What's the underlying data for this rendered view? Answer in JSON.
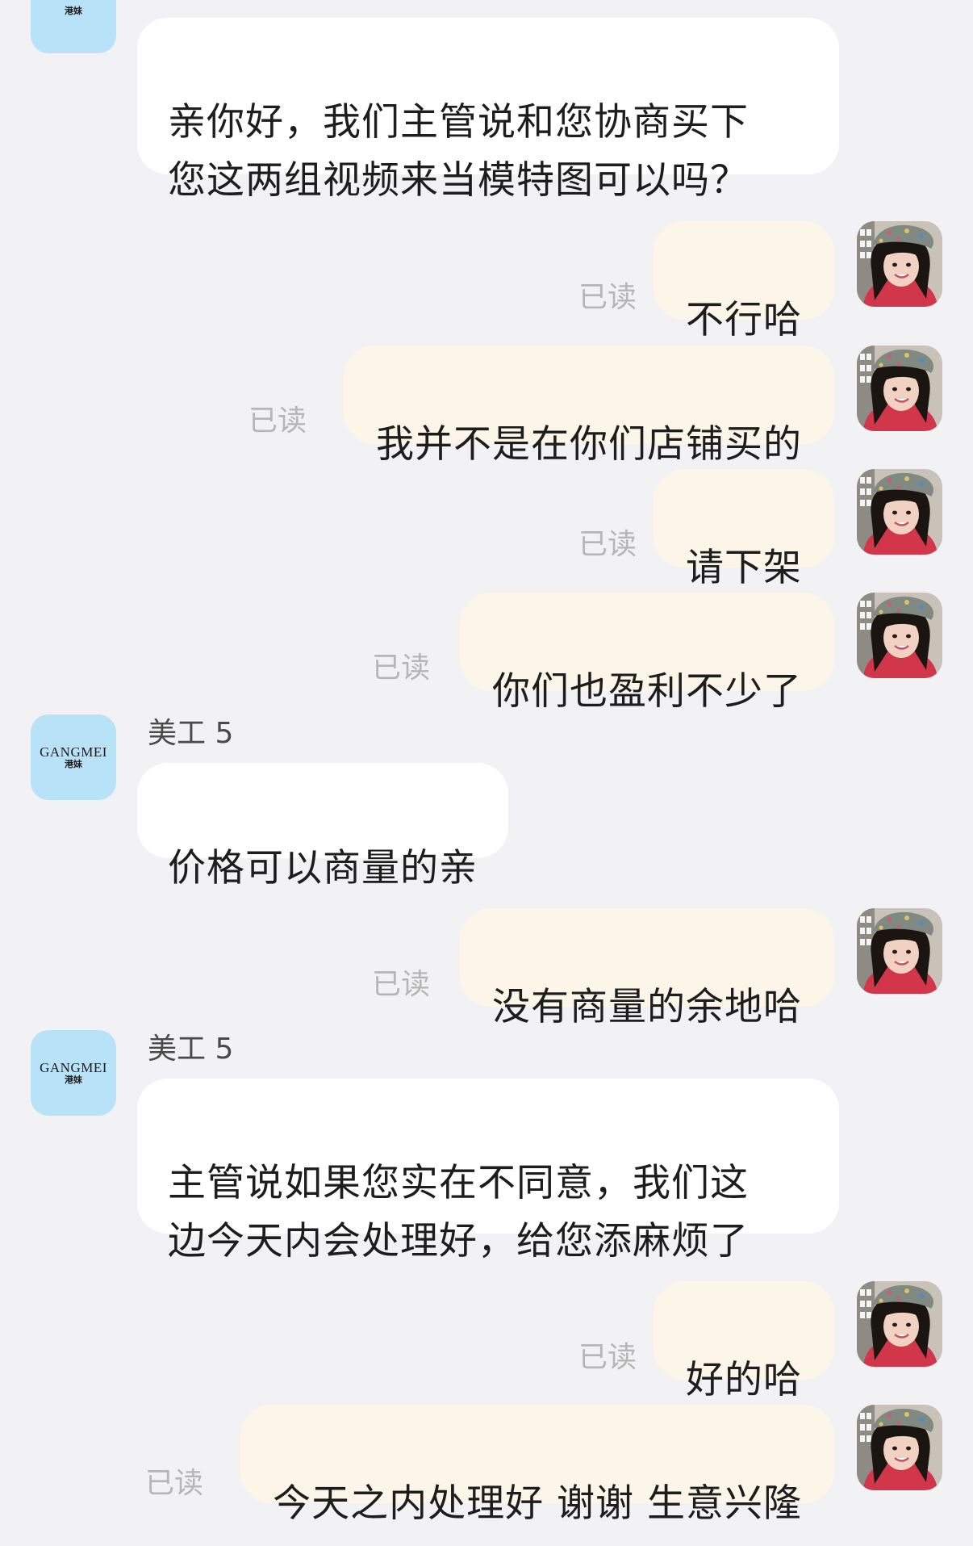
{
  "shop": {
    "avatar_brand": "GANGMEI",
    "avatar_sub": "港妹"
  },
  "read_label": "已读",
  "messages": [
    {
      "side": "left",
      "text": "亲你好，我们主管说和您协商买下\n您这两组视频来当模特图可以吗？"
    },
    {
      "side": "right",
      "text": "不行哈",
      "status": "已读"
    },
    {
      "side": "right",
      "text": "我并不是在你们店铺买的",
      "status": "已读"
    },
    {
      "side": "right",
      "text": "请下架",
      "status": "已读"
    },
    {
      "side": "right",
      "text": "你们也盈利不少了",
      "status": "已读"
    },
    {
      "side": "left",
      "sender": "美工 5",
      "text": "价格可以商量的亲"
    },
    {
      "side": "right",
      "text": "没有商量的余地哈",
      "status": "已读"
    },
    {
      "side": "left",
      "sender": "美工 5",
      "text": "主管说如果您实在不同意，我们这\n边今天内会处理好，给您添麻烦了"
    },
    {
      "side": "right",
      "text": "好的哈",
      "status": "已读"
    },
    {
      "side": "right",
      "text": "今天之内处理好 谢谢 生意兴隆",
      "status": "已读"
    }
  ],
  "colors": {
    "background": "#f2f2f4",
    "left_bubble": "#ffffff",
    "right_bubble": "#fcf6e9",
    "shop_avatar": "#b8e2f7",
    "read_mark": "#b6b6b6"
  }
}
